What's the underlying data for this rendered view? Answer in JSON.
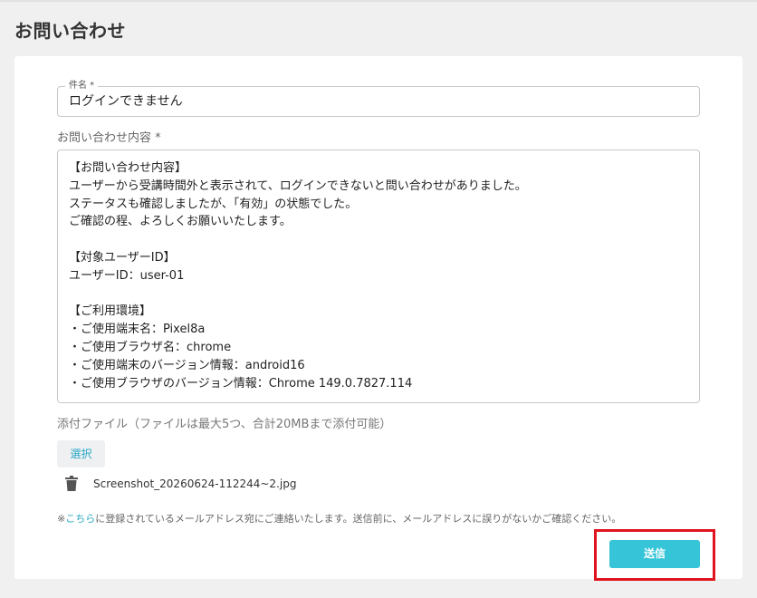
{
  "page": {
    "title": "お問い合わせ"
  },
  "form": {
    "subject": {
      "label": "件名 *",
      "value": "ログインできません"
    },
    "content": {
      "label": "お問い合わせ内容 *",
      "lines": [
        "【お問い合わせ内容】",
        "ユーザーから受講時間外と表示されて、ログインできないと問い合わせがありました。",
        "ステータスも確認しましたが、「有効」の状態でした。",
        "ご確認の程、よろしくお願いいたします。",
        "",
        "【対象ユーザーID】",
        "ユーザーID：user-01",
        "",
        "【ご利用環境】",
        "・ご使用端末名：Pixel8a",
        "・ご使用ブラウザ名：chrome",
        "・ご使用端末のバージョン情報：android16",
        "・ご使用ブラウザのバージョン情報：Chrome 149.0.7827.114"
      ]
    },
    "attachments": {
      "label": "添付ファイル（ファイルは最大5つ、合計20MBまで添付可能）",
      "select_label": "選択",
      "files": [
        {
          "name": "Screenshot_20260624-112244~2.jpg",
          "icon": "trash-icon"
        }
      ]
    },
    "notice": {
      "prefix": "※",
      "link_text": "こちら",
      "text": "に登録されているメールアドレス宛にご連絡いたします。送信前に、メールアドレスに誤りがないかご確認ください。"
    },
    "submit_label": "送信"
  },
  "colors": {
    "accent": "#2aa8c4",
    "submit_bg": "#35c4d8",
    "highlight": "#e0141e"
  }
}
